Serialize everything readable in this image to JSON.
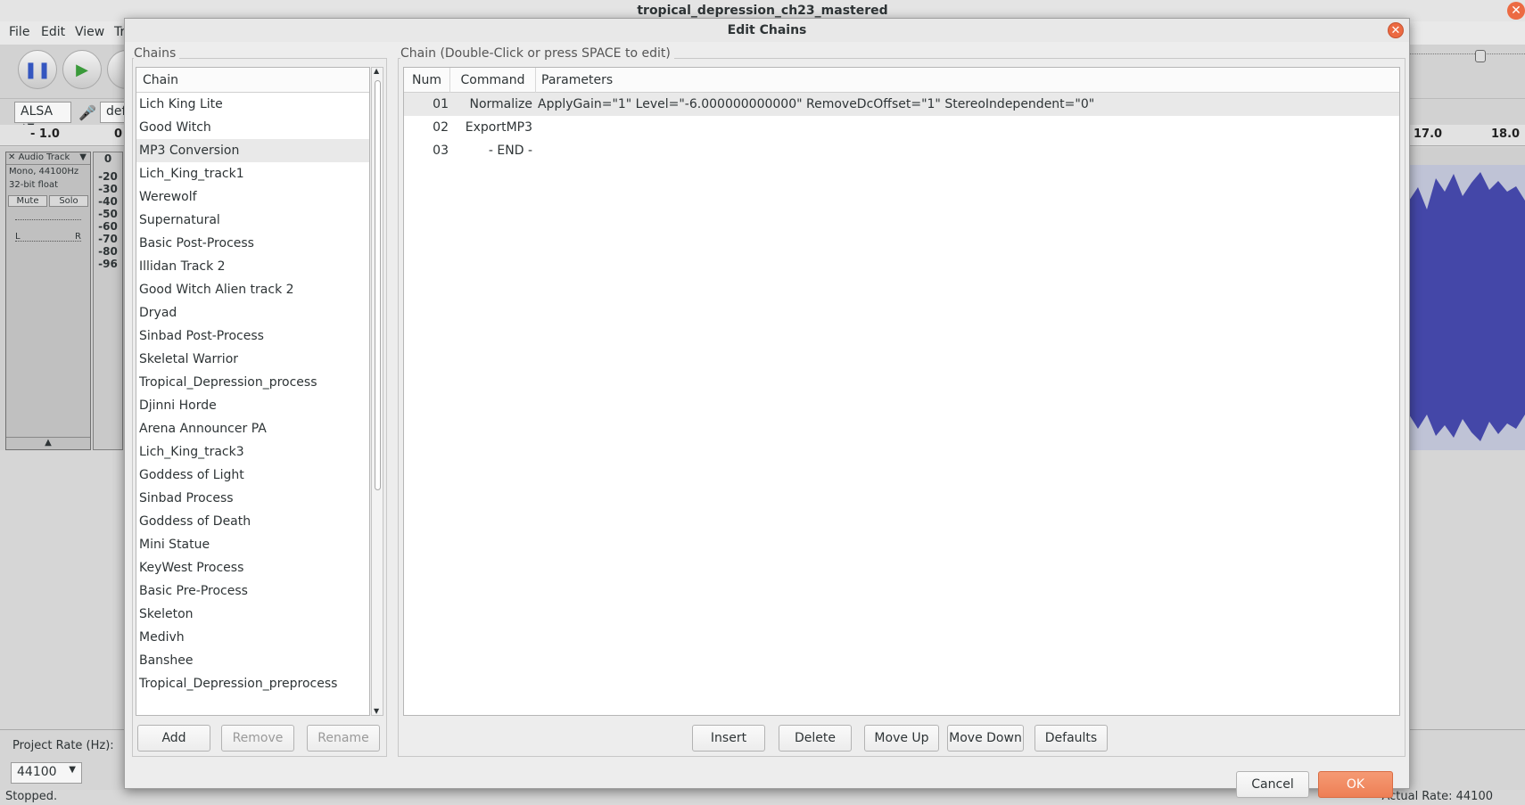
{
  "app": {
    "title": "tropical_depression_ch23_mastered",
    "menu": [
      "File",
      "Edit",
      "View",
      "Tr"
    ],
    "device": {
      "host": "ALSA",
      "input_partial": "defa"
    },
    "ruler": [
      "- 1.0",
      "0",
      "17.0",
      "18.0"
    ],
    "track": {
      "name": "Audio Track",
      "info1": "Mono, 44100Hz",
      "info2": "32-bit float",
      "mute": "Mute",
      "solo": "Solo",
      "left": "L",
      "right": "R"
    },
    "vu_scale": [
      "0",
      "-20",
      "-30",
      "-40",
      "-50",
      "-60",
      "-70",
      "-80",
      "-96"
    ],
    "project_rate_label": "Project Rate (Hz):",
    "project_rate_value": "44100",
    "status_left": "Stopped.",
    "status_right": "Actual Rate: 44100",
    "close_glyph": "✕"
  },
  "dialog": {
    "title": "Edit Chains",
    "close_glyph": "✕",
    "chains_group_label": "Chains",
    "chain_column_header": "Chain",
    "chains": [
      "Lich King Lite",
      "Good Witch",
      "MP3 Conversion",
      "Lich_King_track1",
      "Werewolf",
      "Supernatural",
      "Basic Post-Process",
      "Illidan Track 2",
      "Good Witch Alien track 2",
      "Dryad",
      "Sinbad Post-Process",
      "Skeletal Warrior",
      "Tropical_Depression_process",
      "Djinni Horde",
      "Arena Announcer PA",
      "Lich_King_track3",
      "Goddess of Light",
      "Sinbad Process",
      "Goddess of Death",
      "Mini Statue",
      "KeyWest Process",
      "Basic Pre-Process",
      "Skeleton",
      "Medivh",
      "Banshee",
      "Tropical_Depression_preprocess"
    ],
    "selected_chain_index": 2,
    "chain_group_label": "Chain (Double-Click or press SPACE to edit)",
    "columns": {
      "num": "Num",
      "command": "Command",
      "parameters": "Parameters"
    },
    "commands": [
      {
        "num": "01",
        "command": "Normalize",
        "parameters": "ApplyGain=\"1\" Level=\"-6.000000000000\" RemoveDcOffset=\"1\" StereoIndependent=\"0\""
      },
      {
        "num": "02",
        "command": "ExportMP3",
        "parameters": ""
      },
      {
        "num": "03",
        "command": "- END -",
        "parameters": ""
      }
    ],
    "buttons": {
      "add": "Add",
      "remove": "Remove",
      "rename": "Rename",
      "insert": "Insert",
      "delete": "Delete",
      "move_up": "Move Up",
      "move_down": "Move Down",
      "defaults": "Defaults",
      "cancel": "Cancel",
      "ok": "OK"
    },
    "colors": {
      "ok_button": "#ee7f55",
      "close": "#ec6a42",
      "selection": "#e9e9e9"
    }
  }
}
